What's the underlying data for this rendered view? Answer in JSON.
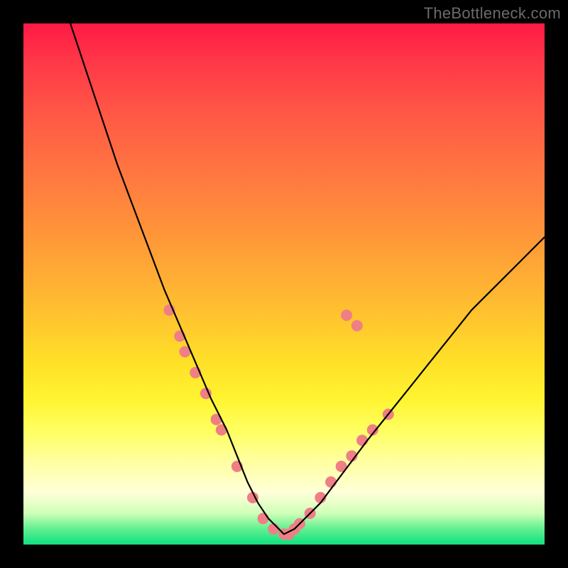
{
  "watermark": "TheBottleneck.com",
  "chart_data": {
    "type": "line",
    "title": "",
    "xlabel": "",
    "ylabel": "",
    "xlim": [
      0,
      100
    ],
    "ylim": [
      0,
      100
    ],
    "series": [
      {
        "name": "curve",
        "x": [
          9,
          12,
          15,
          18,
          21,
          24,
          27,
          30,
          33,
          36,
          39,
          41,
          43,
          45,
          47,
          49,
          50,
          52,
          54,
          57,
          60,
          63,
          66,
          70,
          74,
          78,
          82,
          86,
          90,
          94,
          98,
          100
        ],
        "y": [
          100,
          91,
          82,
          73,
          65,
          57,
          49,
          42,
          35,
          28,
          22,
          17,
          12,
          8,
          5,
          3,
          2,
          3,
          5,
          8,
          12,
          16,
          20,
          25,
          30,
          35,
          40,
          45,
          49,
          53,
          57,
          59
        ]
      }
    ],
    "markers": {
      "color": "#ef7f85",
      "radius_px": 8,
      "points": [
        {
          "x": 28,
          "y": 45
        },
        {
          "x": 30,
          "y": 40
        },
        {
          "x": 31,
          "y": 37
        },
        {
          "x": 33,
          "y": 33
        },
        {
          "x": 35,
          "y": 29
        },
        {
          "x": 37,
          "y": 24
        },
        {
          "x": 38,
          "y": 22
        },
        {
          "x": 41,
          "y": 15
        },
        {
          "x": 44,
          "y": 9
        },
        {
          "x": 46,
          "y": 5
        },
        {
          "x": 48,
          "y": 3
        },
        {
          "x": 50,
          "y": 2
        },
        {
          "x": 51,
          "y": 2
        },
        {
          "x": 52,
          "y": 3
        },
        {
          "x": 53,
          "y": 4
        },
        {
          "x": 55,
          "y": 6
        },
        {
          "x": 57,
          "y": 9
        },
        {
          "x": 59,
          "y": 12
        },
        {
          "x": 61,
          "y": 15
        },
        {
          "x": 63,
          "y": 17
        },
        {
          "x": 65,
          "y": 20
        },
        {
          "x": 67,
          "y": 22
        },
        {
          "x": 70,
          "y": 25
        },
        {
          "x": 62,
          "y": 44
        },
        {
          "x": 64,
          "y": 42
        }
      ]
    }
  }
}
